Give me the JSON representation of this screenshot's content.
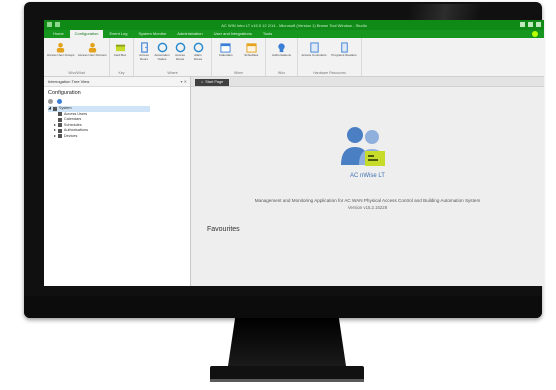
{
  "window": {
    "title": "AC WIN Intro LT v15.5 12 2/14 - Microsoft (Version 1) Brown Tool Window - Studio"
  },
  "ribbon_tabs": [
    "Home",
    "Configuration",
    "Event Log",
    "System Monitor",
    "Administration",
    "User and Integrations",
    "Tools"
  ],
  "active_tab_index": 1,
  "ribbon_groups": [
    {
      "name": "Who/What",
      "buttons": [
        "Access User Groups",
        "Access User Persons"
      ]
    },
    {
      "name": "Key",
      "buttons": [
        "Card Box"
      ]
    },
    {
      "name": "Where",
      "buttons": [
        "Access Doors",
        "Automation Nodes",
        "Access Zones",
        "Alarm Zones"
      ]
    },
    {
      "name": "When",
      "buttons": [
        "Calendars",
        "Schedules"
      ]
    },
    {
      "name": "Who",
      "buttons": [
        "Authorisations"
      ]
    },
    {
      "name": "Hardware Resources",
      "buttons": [
        "Access Controllers",
        "Programs Readers"
      ]
    }
  ],
  "left_pane": {
    "title": "Interrogation Tree View",
    "heading": "Configuration",
    "tree": [
      {
        "label": "System",
        "level": 0,
        "selected": true
      },
      {
        "label": "Access Users",
        "level": 1
      },
      {
        "label": "Calendars",
        "level": 1
      },
      {
        "label": "Schedules",
        "level": 1
      },
      {
        "label": "Authorisations",
        "level": 1
      },
      {
        "label": "Devices",
        "level": 1
      }
    ]
  },
  "doc_tab": {
    "label": "Start Page"
  },
  "start_page": {
    "brand": "AC nWise LT",
    "description": "Management and Monitoring Application for AC WAN Physical Access Control and Building Automation System",
    "version": "Version v15.2.15228",
    "favourites": "Favourites"
  },
  "colors": {
    "accent": "#16951f",
    "titlebar": "#0f8a17",
    "brand_blue": "#3a6fb3",
    "badge": "#c7dc2a"
  }
}
